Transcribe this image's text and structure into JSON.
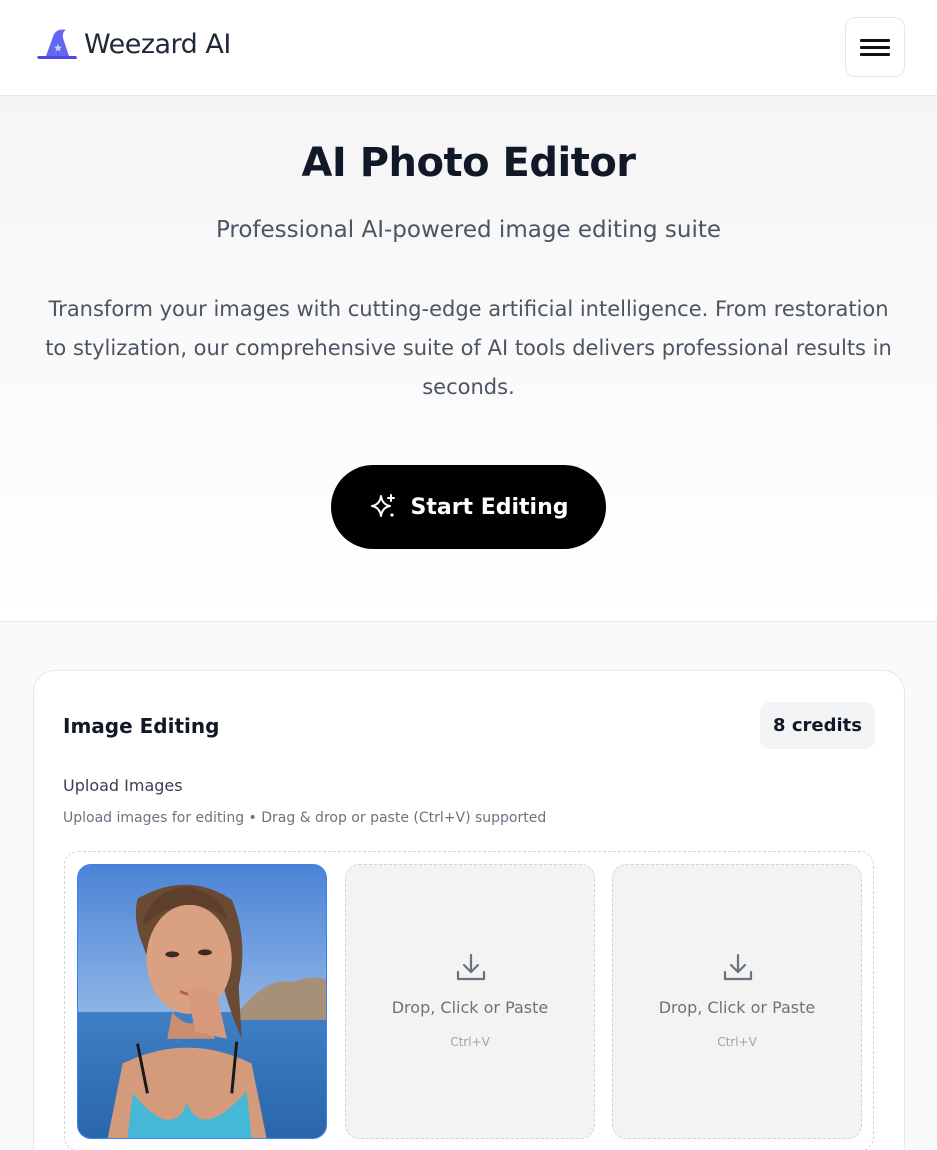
{
  "header": {
    "logo_text": "Weezard AI",
    "logo_icon": "wizard-hat-icon",
    "menu_icon": "hamburger-menu-icon"
  },
  "hero": {
    "title": "AI Photo Editor",
    "subtitle": "Professional AI-powered image editing suite",
    "description": "Transform your images with cutting-edge artificial intelligence. From restoration to stylization, our comprehensive suite of AI tools delivers professional results in seconds.",
    "cta_label": "Start Editing",
    "cta_icon": "sparkle-icon"
  },
  "editor": {
    "title": "Image Editing",
    "credits": "8 credits",
    "upload_label": "Upload Images",
    "upload_help": "Upload images for editing • Drag & drop or paste (Ctrl+V) supported",
    "slots": [
      {
        "type": "image"
      },
      {
        "type": "empty",
        "label": "Drop, Click or Paste",
        "hint": "Ctrl+V",
        "icon": "download-tray-icon"
      },
      {
        "type": "empty",
        "label": "Drop, Click or Paste",
        "hint": "Ctrl+V",
        "icon": "download-tray-icon"
      }
    ]
  },
  "colors": {
    "accent": "#000000",
    "logo": "#4f46e5",
    "text_primary": "#111827",
    "text_secondary": "#4b5563"
  }
}
